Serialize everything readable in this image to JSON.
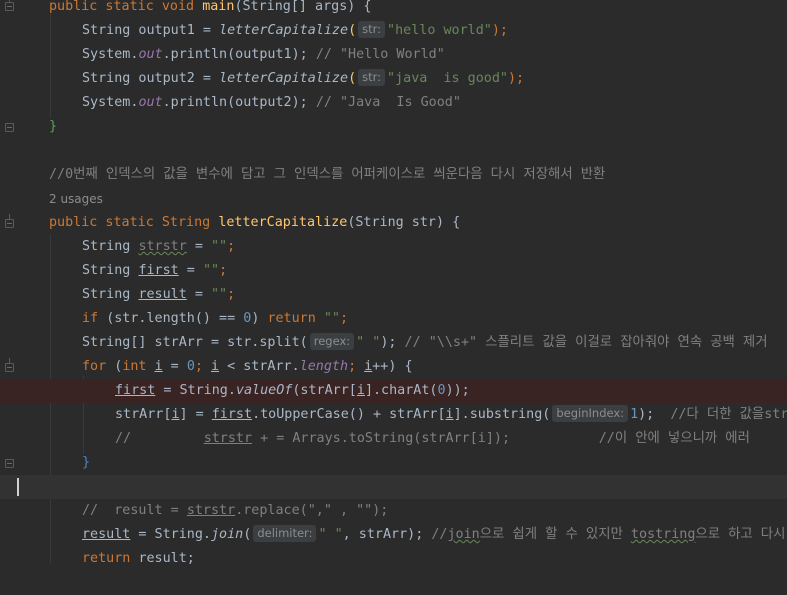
{
  "editor": {
    "usages_label": "2 usages",
    "lines": {
      "l1": {
        "kw1": "public static void ",
        "fn": "main",
        "rest": "(String[] args) {"
      },
      "l2": {
        "a": "String output1 = ",
        "fn": "letterCapitalize",
        "p": "(",
        "hint": "str:",
        "s": "\"hello world\"",
        "e": ");"
      },
      "l3": {
        "a": "System.",
        "sf": "out",
        "b": ".println(output1); ",
        "cm": "// \"Hello World\""
      },
      "l4": {
        "a": "String output2 = ",
        "fn": "letterCapitalize",
        "p": "(",
        "hint": "str:",
        "s": "\"java  is good\"",
        "e": ");"
      },
      "l5": {
        "a": "System.",
        "sf": "out",
        "b": ".println(output2); ",
        "cm": "// \"Java  Is Good\""
      },
      "l6": {
        "a": "}"
      },
      "l8": {
        "cm": "//0번째 인덱스의 값을 변수에 담고 그 인덱스를 어퍼케이스로 씌운다음 다시 저장해서 반환"
      },
      "l10": {
        "kw": "public static ",
        "t": "String ",
        "fn": "letterCapitalize",
        "rest": "(String str) {"
      },
      "l11": {
        "a": "String ",
        "v": "strstr",
        "b": " = ",
        "s": "\"\"",
        "e": ";"
      },
      "l12": {
        "a": "String ",
        "v": "first",
        "b": " = ",
        "s": "\"\"",
        "e": ";"
      },
      "l13": {
        "a": "String ",
        "v": "result",
        "b": " = ",
        "s": "\"\"",
        "e": ";"
      },
      "l14": {
        "kw": "if ",
        "a": "(str.length() == ",
        "n": "0",
        "b": ") ",
        "kw2": "return ",
        "s": "\"\"",
        "e": ";"
      },
      "l15": {
        "a": "String[] strArr = str.split(",
        "hint": "regex:",
        "s": "\" \"",
        "b": "); ",
        "cm": "// \"\\\\s+\" 스플리트 값을 이걸로 잡아줘야 연속 공백 제거"
      },
      "l16": {
        "kw": "for ",
        "a": "(",
        "kw2": "int ",
        "v1": "i",
        "b": " = ",
        "n": "0",
        "c": "; ",
        "v2": "i",
        "d": " < strArr.",
        "sf": "length",
        "e": "; ",
        "v3": "i",
        "f": "++) {"
      },
      "l17": {
        "v": "first",
        "a": " = String.",
        "fi": "valueOf",
        "b": "(strArr[",
        "v2": "i",
        "c": "].charAt(",
        "n": "0",
        "d": "));"
      },
      "l18": {
        "a": "strArr[",
        "v": "i",
        "b": "] = ",
        "v2": "first",
        "c": ".toUpperCase() + strArr[",
        "v3": "i",
        "d": "].substring(",
        "hint": "beginIndex:",
        "n": "1",
        "e": ");  ",
        "cm": "//다 더한 값을strArr"
      },
      "l19": {
        "cm1": "//         ",
        "cmu": "strstr",
        "cm2": " + = Arrays.toString(strArr[i]);           //이 안에 넣으니까 에러"
      },
      "l20": {
        "a": "}"
      },
      "l22": {
        "cm1": "//  result = ",
        "cmu": "strstr",
        "cm2": ".replace(\",\" , \"\");"
      },
      "l23": {
        "v": "result",
        "a": " = String.",
        "fi": "join",
        "b": "(",
        "hint": "delimiter:",
        "s": "\" \"",
        "c": ", strArr); ",
        "cm1": "//",
        "cmu1": "join",
        "cm2": "으로 쉽게 할 수 있지만 ",
        "cmu2": "tostring",
        "cm3": "으로 하고 다시"
      },
      "l24": {
        "kw": "return ",
        "a": "result;"
      }
    }
  },
  "colors": {
    "background": "#2b2b2b",
    "keyword": "#cc7832",
    "function": "#ffc66d",
    "string": "#6a8759",
    "number": "#6897bb",
    "static_field": "#9876aa",
    "comment": "#808080",
    "breakpoint_line": "#3a2323"
  }
}
